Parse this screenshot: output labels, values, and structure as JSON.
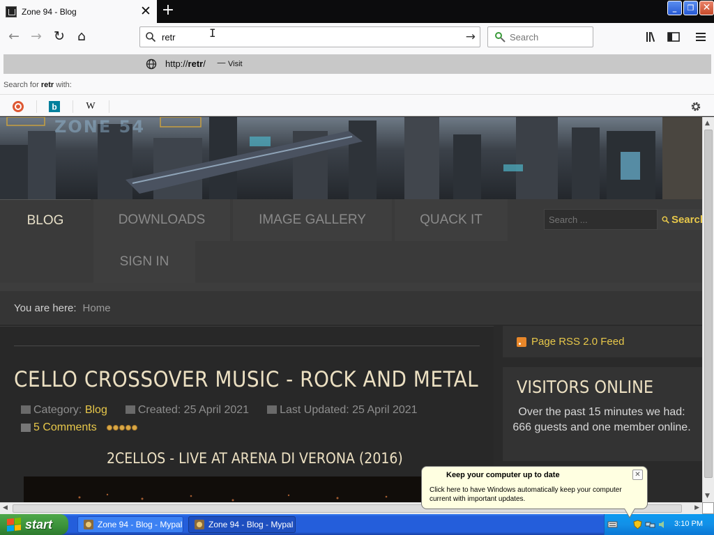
{
  "browser": {
    "tab": {
      "title": "Zone 94 - Blog",
      "close_glyph": "✕"
    },
    "new_tab_glyph": "+",
    "window_controls": {
      "minimize": "_",
      "restore": "❐",
      "close": "✕"
    },
    "nav": {
      "back_glyph": "←",
      "forward_glyph": "→",
      "reload_glyph": "↻",
      "home_glyph": "⌂",
      "go_glyph": "→"
    },
    "url_bar": {
      "value": "retr",
      "icon": "search-icon"
    },
    "search_bar": {
      "placeholder": "Search",
      "icon": "search-engine-icon"
    },
    "toolbar_icons": [
      "library-icon",
      "sidebar-icon",
      "menu-icon"
    ]
  },
  "url_dropdown": {
    "suggestion": {
      "prefix": "http://",
      "bold": "retr",
      "suffix": "/",
      "dash": "—",
      "action": "Visit",
      "icon": "globe-icon"
    },
    "search_for": {
      "prefix": "Search for",
      "term": "retr",
      "suffix": "with:"
    },
    "engines": [
      {
        "name": "duckduckgo-icon",
        "color": "#de5833"
      },
      {
        "name": "bing-icon",
        "color": "#00809d"
      },
      {
        "name": "wikipedia-icon",
        "glyph": "W"
      }
    ],
    "settings_icon": "gear-icon"
  },
  "site": {
    "banner_logo": "ZONE 54",
    "menu": [
      {
        "label": "BLOG",
        "active": true
      },
      {
        "label": "DOWNLOADS"
      },
      {
        "label": "IMAGE GALLERY"
      },
      {
        "label": "QUACK IT"
      },
      {
        "label": "SIGN IN"
      }
    ],
    "search": {
      "placeholder": "Search ...",
      "button": "Search"
    },
    "breadcrumb": {
      "label": "You are here:",
      "home": "Home"
    },
    "article": {
      "title": "CELLO CROSSOVER MUSIC - ROCK AND METAL",
      "category_label": "Category:",
      "category": "Blog",
      "created": "Created: 25 April 2021",
      "updated": "Last Updated: 25 April 2021",
      "comments": "5 Comments",
      "rating": 5,
      "video_title": "2CELLOS - LIVE AT ARENA DI VERONA (2016)"
    },
    "sidebar": {
      "rss": "Page RSS 2.0 Feed",
      "visitors_title": "VISITORS ONLINE",
      "visitors_text": "Over the past 15 minutes we had: 666 guests and one member online."
    }
  },
  "scrollbars": {
    "up": "▲",
    "down": "▼",
    "left": "◀",
    "right": "▶"
  },
  "taskbar": {
    "start": "start",
    "tasks": [
      {
        "label": "Zone 94 - Blog - Mypal",
        "active": false
      },
      {
        "label": "Zone 94 - Blog - Mypal",
        "active": true
      }
    ],
    "clock": "3:10 PM"
  },
  "balloon": {
    "title": "Keep your computer up to date",
    "text": "Click here to have Windows automatically keep your computer current with important updates.",
    "close": "✕"
  }
}
